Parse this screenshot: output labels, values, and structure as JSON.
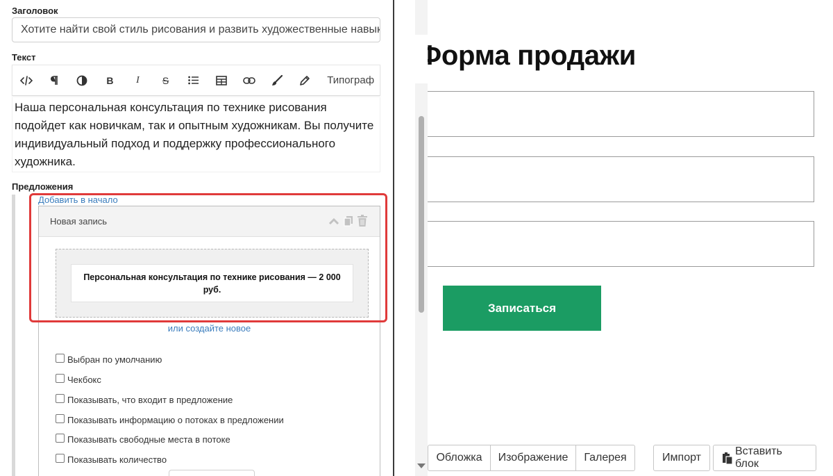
{
  "editor": {
    "title_label": "Заголовок",
    "title_value": "Хотите найти свой стиль рисования и развить художественные навыки",
    "text_label": "Текст",
    "toolbar": {
      "icons": [
        "code-view-icon",
        "paragraph-icon",
        "contrast-icon",
        "bold-icon",
        "italic-icon",
        "strikethrough-icon",
        "bullet-list-icon",
        "table-icon",
        "link-icon",
        "brush-icon",
        "pencil-icon"
      ],
      "bold_label": "B",
      "italic_label": "I",
      "strike_label": "S",
      "typograph_label": "Типограф"
    },
    "body_text": "Наша персональная консультация по технике рисования подойдет как новичкам, так и опытным художникам. Вы получите индивидуальный подход и поддержку профессионального художника."
  },
  "offers": {
    "label": "Предложения",
    "add_start_link": "Добавить в начало",
    "record": {
      "title": "Новая запись",
      "selected_offer": "Персональная консультация по технике рисования — 2 000 руб.",
      "create_new_link": "или создайте новое",
      "checkboxes": [
        {
          "label": "Выбран по умолчанию",
          "checked": false
        },
        {
          "label": "Чекбокс",
          "checked": false
        },
        {
          "label": "Показывать, что входит в предложение",
          "checked": false
        },
        {
          "label": "Показывать информацию о потоках в предложении",
          "checked": false
        },
        {
          "label": "Показывать свободные места в потоке",
          "checked": false
        },
        {
          "label": "Показывать количество",
          "checked": false
        }
      ]
    },
    "highlight_color": "#e03a3a"
  },
  "preview": {
    "heading": "Форма продажи",
    "submit_label": "Записаться",
    "submit_color": "#1b9c63"
  },
  "bottom_bar": {
    "segment": [
      "Обложка",
      "Изображение",
      "Галерея"
    ],
    "import_label": "Импорт",
    "paste_label": "Вставить блок"
  }
}
